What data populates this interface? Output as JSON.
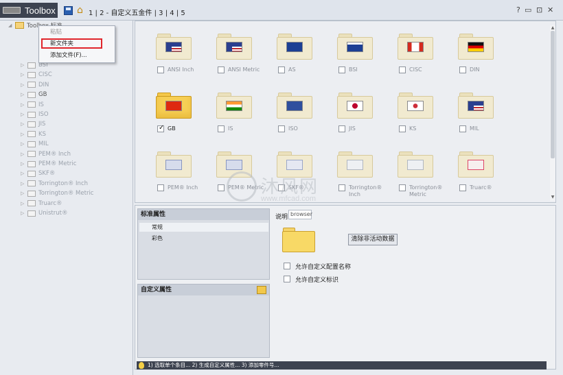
{
  "titlebar": {
    "app_title": "Toolbox",
    "crumb_1": "1",
    "crumb_2": "2 - 自定义五金件",
    "crumb_3": "3",
    "crumb_4": "4",
    "crumb_5": "5",
    "help_icon": "?",
    "min_icon": "▭",
    "restore_icon": "⊡",
    "close_icon": "✕"
  },
  "tree": {
    "root_label": "Toolbox 标准",
    "items": [
      {
        "label": "BSI",
        "dim": true
      },
      {
        "label": "CISC",
        "dim": true
      },
      {
        "label": "DIN",
        "dim": true
      },
      {
        "label": "GB",
        "dim": false
      },
      {
        "label": "IS",
        "dim": true
      },
      {
        "label": "ISO",
        "dim": true
      },
      {
        "label": "JIS",
        "dim": true
      },
      {
        "label": "KS",
        "dim": true
      },
      {
        "label": "MIL",
        "dim": true
      },
      {
        "label": "PEM® Inch",
        "dim": true
      },
      {
        "label": "PEM® Metric",
        "dim": true
      },
      {
        "label": "SKF®",
        "dim": true
      },
      {
        "label": "Torrington® Inch",
        "dim": true
      },
      {
        "label": "Torrington® Metric",
        "dim": true
      },
      {
        "label": "Truarc®",
        "dim": true
      },
      {
        "label": "Unistrut®",
        "dim": true
      }
    ]
  },
  "context_menu": {
    "paste": "粘贴",
    "new_folder": "新文件夹",
    "add_file": "添加文件(F)..."
  },
  "grid": {
    "cards": [
      {
        "label": "ANSI Inch",
        "checked": false,
        "flag": "us"
      },
      {
        "label": "ANSI Metric",
        "checked": false,
        "flag": "us"
      },
      {
        "label": "AS",
        "checked": false,
        "flag": "au"
      },
      {
        "label": "BSI",
        "checked": false,
        "flag": "uk"
      },
      {
        "label": "CISC",
        "checked": false,
        "flag": "ca"
      },
      {
        "label": "DIN",
        "checked": false,
        "flag": "de"
      },
      {
        "label": "GB",
        "checked": true,
        "flag": "cn"
      },
      {
        "label": "IS",
        "checked": false,
        "flag": "in"
      },
      {
        "label": "ISO",
        "checked": false,
        "flag": "iso"
      },
      {
        "label": "JIS",
        "checked": false,
        "flag": "jp"
      },
      {
        "label": "KS",
        "checked": false,
        "flag": "kr"
      },
      {
        "label": "MIL",
        "checked": false,
        "flag": "us"
      },
      {
        "label": "PEM® Inch",
        "checked": false,
        "flag": "pem"
      },
      {
        "label": "PEM® Metric",
        "checked": false,
        "flag": "pem"
      },
      {
        "label": "SKF®",
        "checked": false,
        "flag": "skf"
      },
      {
        "label": "Torrington® Inch",
        "checked": false,
        "flag": "tor"
      },
      {
        "label": "Torrington® Metric",
        "checked": false,
        "flag": "tor"
      },
      {
        "label": "Truarc®",
        "checked": false,
        "flag": "tru"
      }
    ]
  },
  "watermark": {
    "text": "沐风网",
    "sub": "www.mfcad.com"
  },
  "properties": {
    "standard_header": "标准属性",
    "row_general": "常规",
    "row_color": "彩色",
    "custom_header": "自定义属性",
    "desc_label": "说明",
    "desc_value": "browser",
    "clear_button": "清除非活动数据",
    "opt_config_name": "允许自定义配置名称",
    "opt_custom_id": "允许自定义标识"
  },
  "statusbar": {
    "text": "1) 选取单个条目... 2) 生成自定义属性... 3) 添加零件号..."
  },
  "colors": {
    "titlebar_dark": "#3d4350",
    "highlight_red": "#e0252b",
    "folder_active": "#f7cf55"
  }
}
